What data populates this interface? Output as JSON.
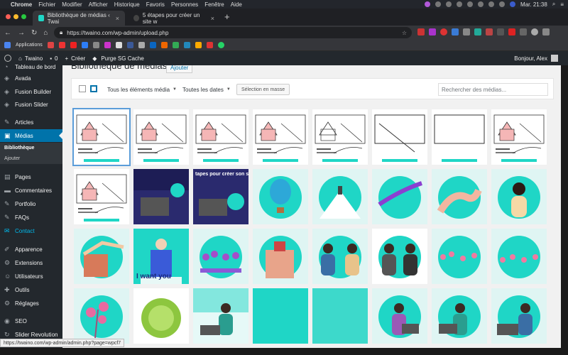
{
  "macos": {
    "app": "Chrome",
    "menus": [
      "Fichier",
      "Modifier",
      "Afficher",
      "Historique",
      "Favoris",
      "Personnes",
      "Fenêtre",
      "Aide"
    ],
    "clock": "Mar. 21:38"
  },
  "tabs": [
    {
      "title": "Bibliothèque de médias ‹ Twai",
      "active": true
    },
    {
      "title": "5 étapes pour créer un site w",
      "active": false
    }
  ],
  "address": {
    "url": "https://twaino.com/wp-admin/upload.php"
  },
  "bookmarks": {
    "apps_label": "Applications"
  },
  "adminbar": {
    "site": "Twaino",
    "comments": "0",
    "new": "Créer",
    "cache": "Purge SG Cache",
    "greeting": "Bonjour, Alex"
  },
  "sidebar": {
    "items": [
      {
        "label": "Tableau de bord",
        "icon": "dashboard-icon"
      },
      {
        "label": "Avada",
        "icon": "avada-icon"
      },
      {
        "label": "Fusion Builder",
        "icon": "fusion-builder-icon"
      },
      {
        "label": "Fusion Slider",
        "icon": "fusion-slider-icon"
      },
      {
        "label": "Articles",
        "icon": "pin-icon"
      },
      {
        "label": "Médias",
        "icon": "media-icon"
      },
      {
        "label": "Pages",
        "icon": "pages-icon"
      },
      {
        "label": "Commentaires",
        "icon": "comments-icon"
      },
      {
        "label": "Portfolio",
        "icon": "portfolio-icon"
      },
      {
        "label": "FAQs",
        "icon": "faq-icon"
      },
      {
        "label": "Contact",
        "icon": "mail-icon"
      },
      {
        "label": "Apparence",
        "icon": "brush-icon"
      },
      {
        "label": "Extensions",
        "icon": "plugin-icon"
      },
      {
        "label": "Utilisateurs",
        "icon": "users-icon"
      },
      {
        "label": "Outils",
        "icon": "tools-icon"
      },
      {
        "label": "Réglages",
        "icon": "settings-icon"
      },
      {
        "label": "SEO",
        "icon": "seo-icon"
      },
      {
        "label": "Slider Revolution",
        "icon": "slider-icon"
      }
    ],
    "submenu": [
      "Bibliothèque",
      "Ajouter"
    ]
  },
  "main": {
    "title": "Bibliothèque de médias",
    "add_label": "Ajouter",
    "filter_type": "Tous les éléments média",
    "filter_date": "Toutes les dates",
    "bulk_label": "Sélection en masse",
    "search_placeholder": "Rechercher des médias...",
    "tile_texts": {
      "banner_overlay": "tapes pour créer son site",
      "i_want": "I want you"
    }
  },
  "status_url": "https://twaino.com/wp-admin/admin.php?page=wpcf7",
  "colors": {
    "teal": "#1fd6c6",
    "wp_blue": "#0073aa",
    "admin_dark": "#23282d"
  }
}
